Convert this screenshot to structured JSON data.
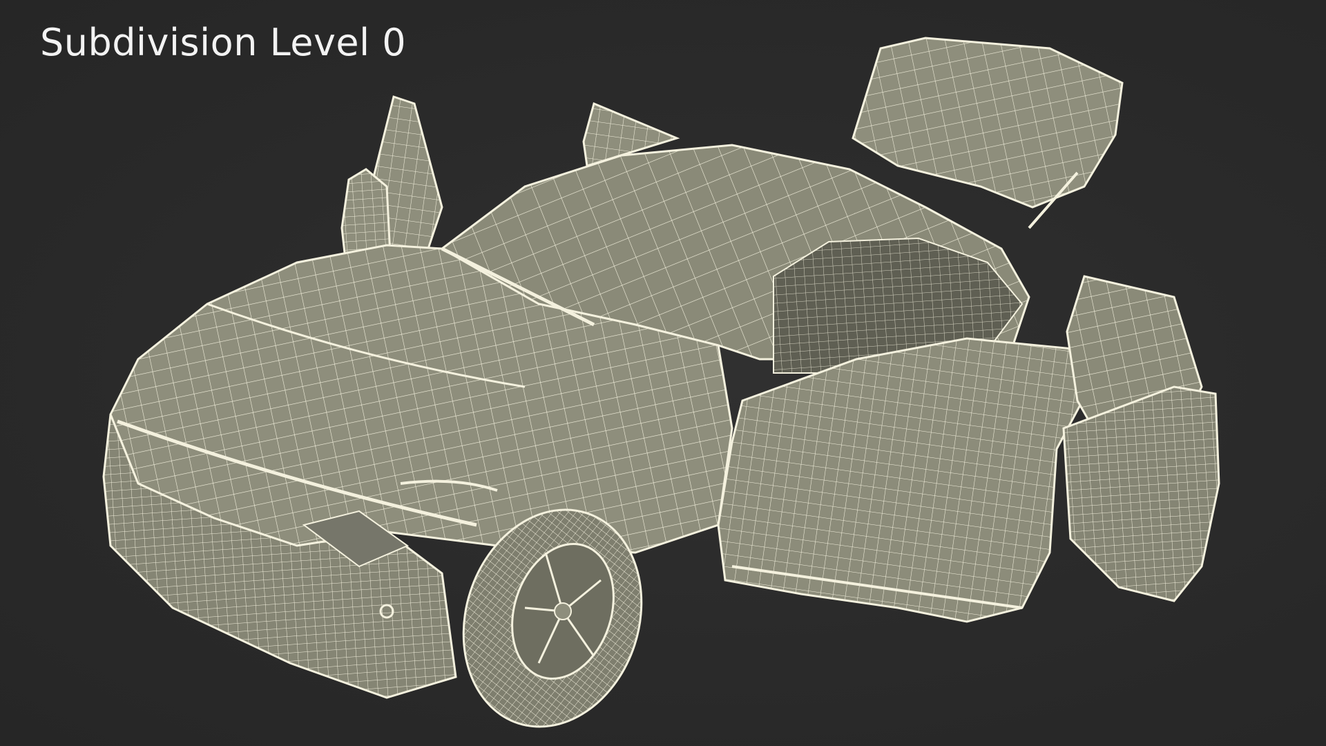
{
  "overlay": {
    "label": "Subdivision Level 0"
  },
  "render": {
    "background_color": "#2a2a2a",
    "mesh_fill_color": "#8e8e7c",
    "mesh_shadow_color": "#6c6c5e",
    "wire_color": "#f4f1de"
  }
}
